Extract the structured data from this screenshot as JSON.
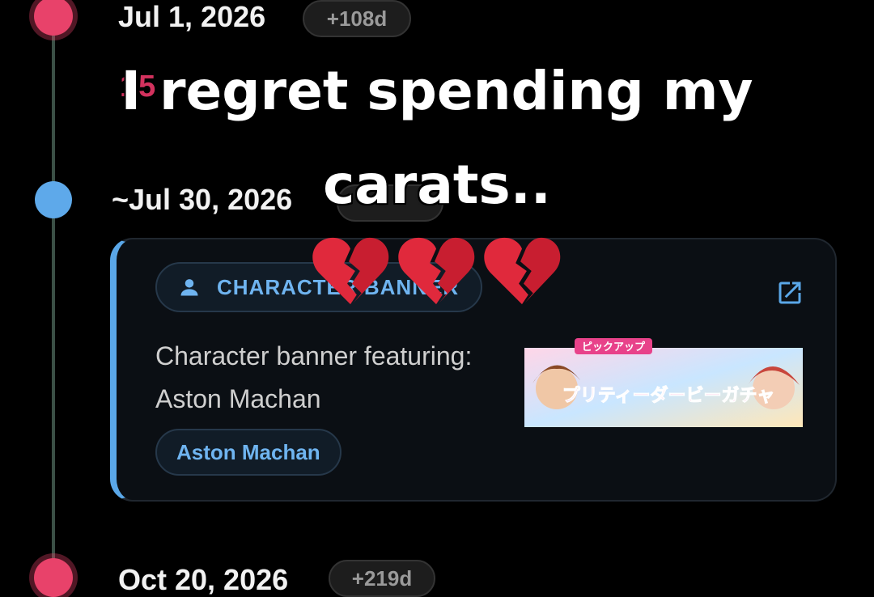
{
  "timeline": {
    "events": [
      {
        "date": "Jul 1, 2026",
        "offset": "+108d",
        "subtext": "15"
      },
      {
        "date": "~Jul 30, 2026",
        "offset": ""
      },
      {
        "date": "Oct 20, 2026",
        "offset": "+219d"
      }
    ]
  },
  "card": {
    "type_label": "CHARACTER BANNER",
    "description": "Character banner featuring: Aston Machan",
    "character_tag": "Aston Machan",
    "banner_text": {
      "top": "ピックアップ",
      "main": "プリティーダービーガチャ"
    }
  },
  "overlay": {
    "caption_line1": "I regret spending my",
    "caption_line2": "carats..",
    "emoji": [
      "💔",
      "💔",
      "💔"
    ]
  },
  "colors": {
    "accent_pink": "#e8426a",
    "accent_blue": "#5ea9ea",
    "background": "#000000"
  },
  "icons": {
    "person": "person-icon",
    "external": "external-link-icon",
    "heart": "broken-heart-icon"
  }
}
